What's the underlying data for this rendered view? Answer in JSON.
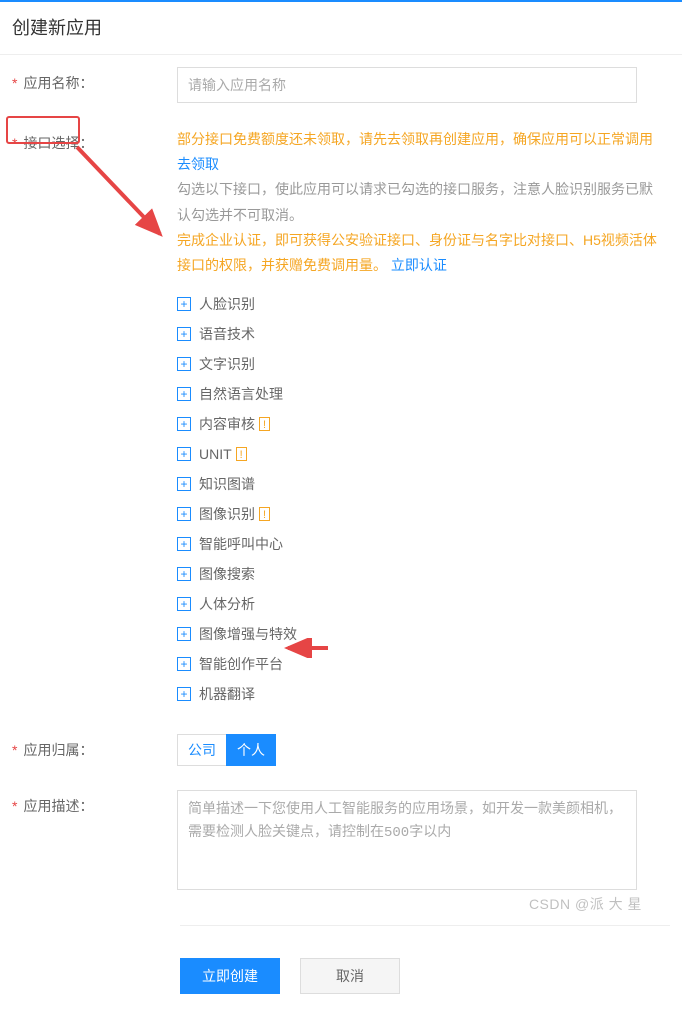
{
  "page_title": "创建新应用",
  "labels": {
    "app_name": "应用名称：",
    "interface_select": "接口选择：",
    "app_belong": "应用归属：",
    "app_desc": "应用描述："
  },
  "app_name_placeholder": "请输入应用名称",
  "tips": {
    "line1_orange": "部分接口免费额度还未领取，请先去领取再创建应用，确保应用可以正常调用",
    "line1_link": "去领取",
    "line2_gray": "勾选以下接口，使此应用可以请求已勾选的接口服务，注意人脸识别服务已默认勾选并不可取消。",
    "line3_orange": "完成企业认证，即可获得公安验证接口、身份证与名字比对接口、H5视频活体接口的权限，并获赠免费调用量。",
    "line3_link": "立即认证"
  },
  "tree": [
    {
      "label": "人脸识别",
      "badge": ""
    },
    {
      "label": "语音技术",
      "badge": ""
    },
    {
      "label": "文字识别",
      "badge": ""
    },
    {
      "label": "自然语言处理",
      "badge": ""
    },
    {
      "label": "内容审核",
      "badge": "!"
    },
    {
      "label": "UNIT",
      "badge": "!"
    },
    {
      "label": "知识图谱",
      "badge": ""
    },
    {
      "label": "图像识别",
      "badge": "!"
    },
    {
      "label": "智能呼叫中心",
      "badge": ""
    },
    {
      "label": "图像搜索",
      "badge": ""
    },
    {
      "label": "人体分析",
      "badge": ""
    },
    {
      "label": "图像增强与特效",
      "badge": ""
    },
    {
      "label": "智能创作平台",
      "badge": ""
    },
    {
      "label": "机器翻译",
      "badge": ""
    }
  ],
  "belong_options": {
    "company": "公司",
    "personal": "个人"
  },
  "belong_selected": "个人",
  "desc_placeholder": "简单描述一下您使用人工智能服务的应用场景，如开发一款美颜相机，需要检测人脸关键点，请控制在500字以内",
  "buttons": {
    "create": "立即创建",
    "cancel": "取消"
  },
  "watermark": "CSDN @派 大 星"
}
